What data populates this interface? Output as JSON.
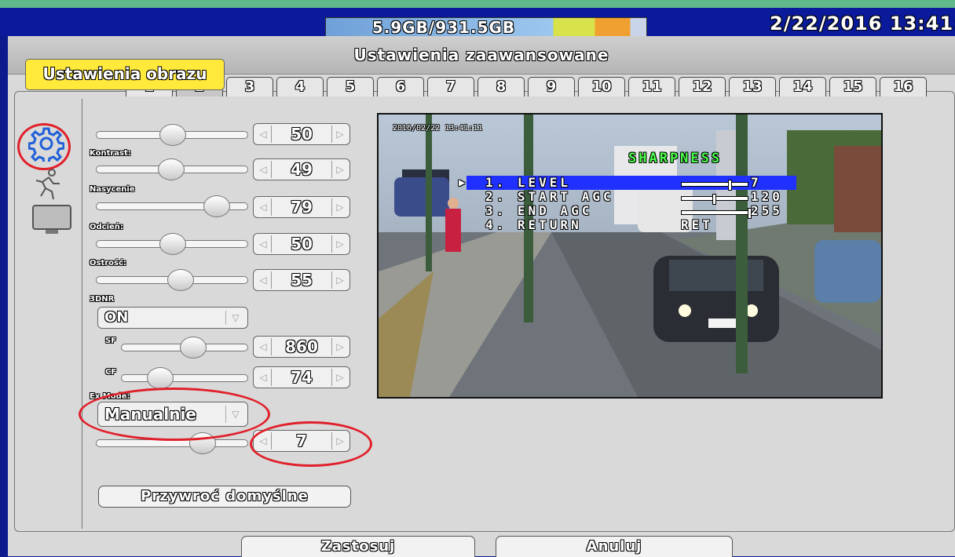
{
  "topbar": {
    "storage": "5.9GB/931.5GB",
    "datetime": "2/22/2016 13:41:"
  },
  "window": {
    "title": "Ustawienia zaawansowane",
    "tabs": [
      "1",
      "2",
      "3",
      "4",
      "5",
      "6",
      "7",
      "8",
      "9",
      "10",
      "11",
      "12",
      "13",
      "14",
      "15",
      "16"
    ],
    "active_tab": "2"
  },
  "tooltip": "Ustawienia obrazu",
  "icons": [
    "gear-icon",
    "running-person-icon",
    "monitor-icon"
  ],
  "settings": {
    "brightness": {
      "value": "50",
      "level": 0.5
    },
    "contrast": {
      "label": "Kontrast:",
      "value": "49",
      "level": 0.49
    },
    "saturation": {
      "label": "Nasycenie",
      "value": "79",
      "level": 0.79
    },
    "hue": {
      "label": "Odcień:",
      "value": "50",
      "level": 0.5
    },
    "sharpness": {
      "label": "Ostrość:",
      "value": "55",
      "level": 0.55
    },
    "dnr": {
      "label": "3DNR",
      "value": "ON"
    },
    "sf": {
      "label": "SF",
      "value": "860",
      "level": 0.56
    },
    "cf": {
      "label": "CF",
      "value": "74",
      "level": 0.3
    },
    "ex_mode": {
      "label": "Ex Mode:",
      "value": "Manualnie"
    },
    "ex_level": {
      "value": "7",
      "level": 0.7
    }
  },
  "buttons": {
    "restore": "Przywroć domyślne",
    "apply": "Zastosuj",
    "cancel": "Anuluj"
  },
  "preview_osd": {
    "timestamp": "2016/02/22 13:41:11",
    "menu_title": "SHARPNESS",
    "items": [
      {
        "label": "1. LEVEL",
        "value": "7",
        "level": 0.7
      },
      {
        "label": "2. START AGC",
        "value": "120",
        "level": 0.47
      },
      {
        "label": "3. END AGC",
        "value": "255",
        "level": 1.0
      },
      {
        "label": "4. RETURN",
        "value": "RET"
      }
    ]
  },
  "colors": {
    "accent_blue": "#0a1a9a",
    "tooltip_yellow": "#ffe93a",
    "annotation_red": "#e0202a",
    "osd_green": "#4cff4c"
  }
}
